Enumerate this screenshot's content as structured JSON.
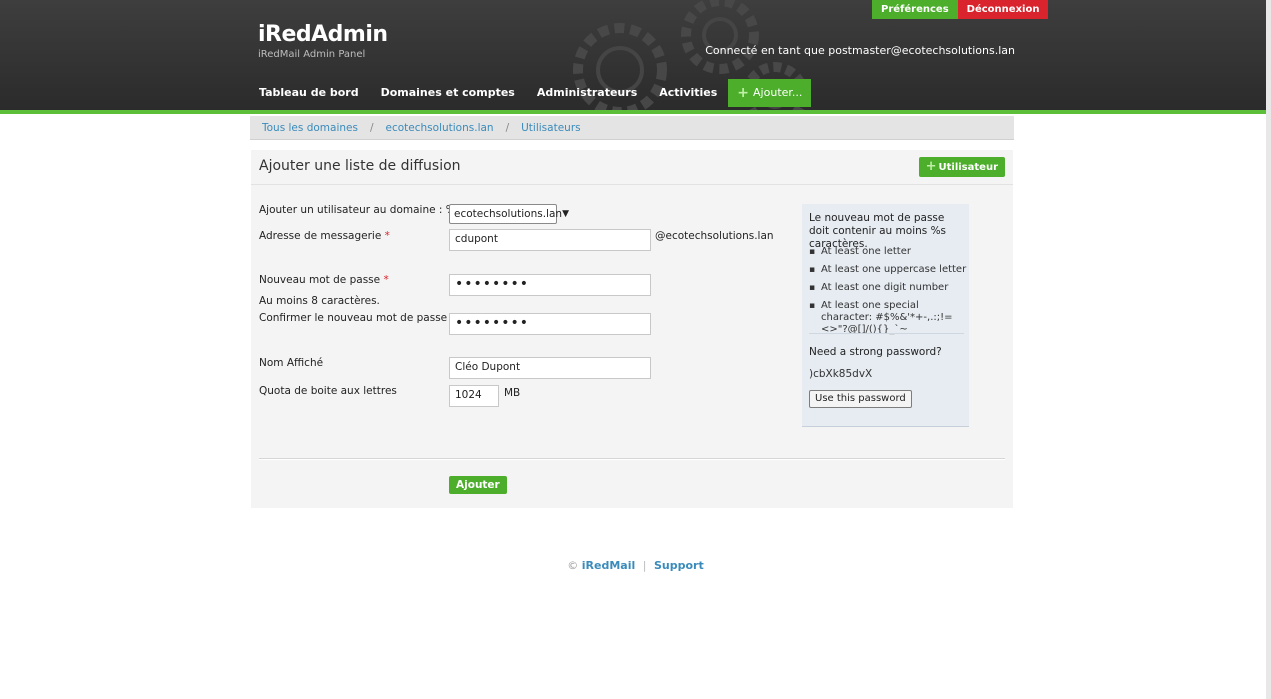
{
  "brand": {
    "title": "iRedAdmin",
    "subtitle": "iRedMail Admin Panel"
  },
  "top_links": {
    "preferences": "Préférences",
    "logout": "Déconnexion"
  },
  "logged_in": "Connecté en tant que postmaster@ecotechsolutions.lan",
  "nav": {
    "items": [
      "Tableau de bord",
      "Domaines et comptes",
      "Administrateurs",
      "Activities"
    ],
    "add_label": "Ajouter..."
  },
  "breadcrumb": [
    "Tous les domaines",
    "ecotechsolutions.lan",
    "Utilisateurs"
  ],
  "panel": {
    "title": "Ajouter une liste de diffusion",
    "user_button": "Utilisateur"
  },
  "form": {
    "domain_label": "Ajouter un utilisateur au domaine : %s.",
    "domain_value": "ecotechsolutions.lan",
    "email_label": "Adresse de messagerie",
    "email_value": "cdupont",
    "email_suffix": "@ecotechsolutions.lan",
    "password_label": "Nouveau mot de passe",
    "password_hint": "Au moins 8 caractères.",
    "password_mask": "••••••••",
    "confirm_label": "Confirmer le nouveau mot de passe",
    "confirm_mask": "••••••••",
    "display_name_label": "Nom Affiché",
    "display_name_value": "Cléo Dupont",
    "quota_label": "Quota de boite aux lettres",
    "quota_value": "1024",
    "quota_unit": "MB",
    "required_mark": "*",
    "submit": "Ajouter"
  },
  "info": {
    "title": "Le nouveau mot de passe doit contenir au moins %s caractères.",
    "rules": [
      "At least one letter",
      "At least one uppercase letter",
      "At least one digit number",
      "At least one special character: #$%&'*+-,.:;!=<>\"?@[]/(){}_`~"
    ],
    "strong_question": "Need a strong password?",
    "generated": ")cbXk85dvX",
    "use_button": "Use this password"
  },
  "footer": {
    "copyright": "©",
    "brand_link": "iRedMail",
    "separator": "|",
    "support_link": "Support"
  },
  "colors": {
    "accent_green": "#4cae2a",
    "logout_red": "#d9232d",
    "link_blue": "#3a8bbb",
    "header_dark": "#333333"
  }
}
